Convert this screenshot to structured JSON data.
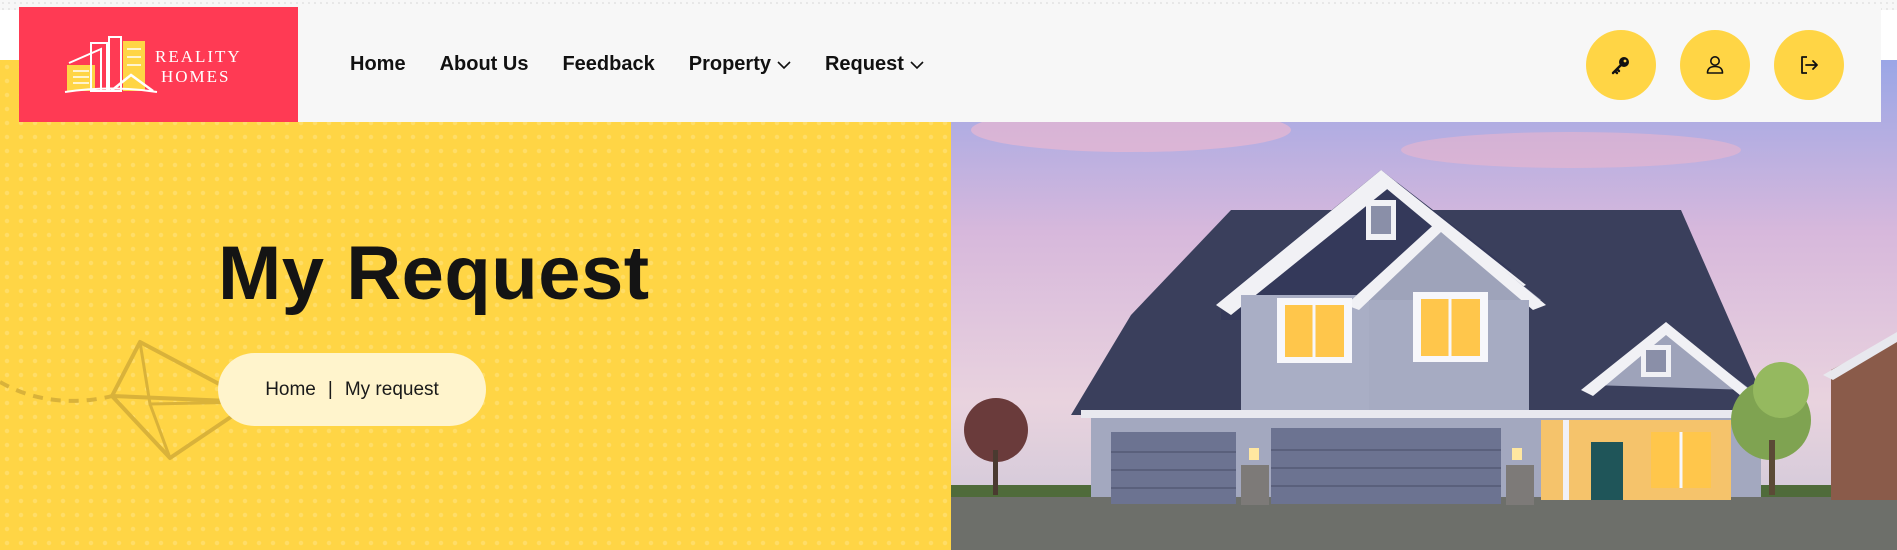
{
  "brand": {
    "line1": "REALITY",
    "line2": "HOMES",
    "color": "#ff3a54"
  },
  "nav": {
    "home": "Home",
    "about": "About Us",
    "feedback": "Feedback",
    "property": "Property",
    "request": "Request"
  },
  "actions": {
    "accent": "#ffd545",
    "icons": [
      "key-icon",
      "user-icon",
      "logout-icon"
    ]
  },
  "hero": {
    "title": "My Request",
    "breadcrumb": {
      "home": "Home",
      "separator": "|",
      "current": "My request"
    },
    "panel_color": "#ffd545"
  }
}
